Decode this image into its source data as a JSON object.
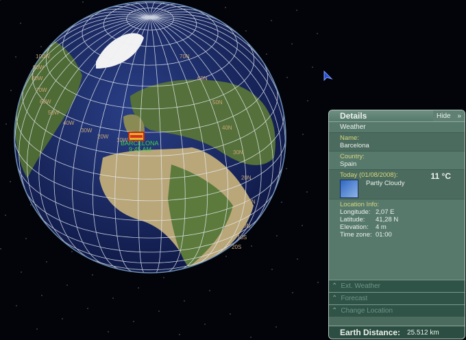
{
  "globe": {
    "city_label": "BARCELONA",
    "city_time": "9:45 AM",
    "lon_labels": [
      "100W",
      "90W",
      "80W",
      "70W",
      "60W",
      "50W",
      "40W",
      "30W",
      "20W",
      "10W"
    ],
    "lat_labels": [
      "70N",
      "60N",
      "50N",
      "40N",
      "30N",
      "20N",
      "10N",
      "0N",
      "10S",
      "20S"
    ]
  },
  "panel": {
    "title": "Details",
    "hide_label": "Hide",
    "hide_icon": "double-chevron-down",
    "section": "Weather",
    "name_label": "Name:",
    "name": "Barcelona",
    "country_label": "Country:",
    "country": "Spain",
    "today_label": "Today (01/08/2008):",
    "temperature": "11 °C",
    "condition": "Partly Cloudy",
    "location_label": "Location Info:",
    "location": [
      {
        "k": "Longitude:",
        "v": "2,07 E"
      },
      {
        "k": "Latitude:",
        "v": "41,28 N"
      },
      {
        "k": "Elevation:",
        "v": "4 m"
      },
      {
        "k": "Time zone:",
        "v": "01:00"
      }
    ],
    "collapsed": [
      "Ext. Weather",
      "Forecast",
      "Change Location"
    ],
    "distance_label": "Earth Distance:",
    "distance": "25.512 km"
  },
  "colors": {
    "panel": "#4b6b5e",
    "label": "#d8d77e",
    "ocean": "#1d2f6e"
  }
}
